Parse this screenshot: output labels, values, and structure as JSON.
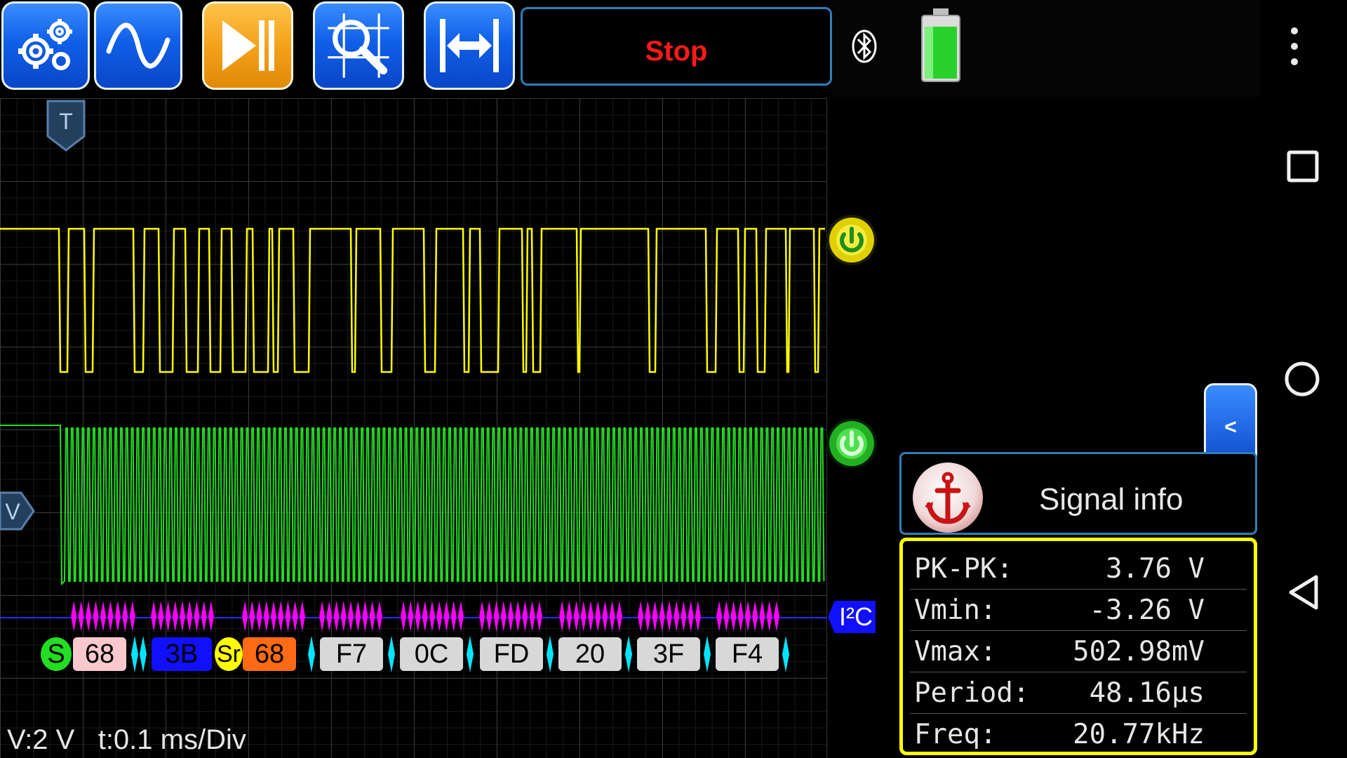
{
  "toolbar": {
    "stop_label": "Stop"
  },
  "scope": {
    "trigger_marker": "T",
    "volt_marker": "V",
    "bus_label": "I²C",
    "volts_per_div": "V:2 V",
    "time_per_div": "t:0.1 ms/Div"
  },
  "decode": {
    "start1": "S",
    "start2": "Sr",
    "bytes": [
      "68",
      "3B",
      "68",
      "F7",
      "0C",
      "FD",
      "20",
      "3F",
      "F4"
    ]
  },
  "signal_info": {
    "collapse": "<",
    "title": "Signal info",
    "rows": [
      {
        "label": "PK-PK:",
        "value": "3.76 V"
      },
      {
        "label": "Vmin:",
        "value": "-3.26 V"
      },
      {
        "label": "Vmax:",
        "value": "502.98mV"
      },
      {
        "label": "Period:",
        "value": "48.16µs"
      },
      {
        "label": "Freq:",
        "value": "20.77kHz"
      }
    ]
  },
  "colors": {
    "ch1": "#ffff00",
    "ch2": "#22dd22",
    "decode_marker": "#ff00ff",
    "separator": "#00e5ff",
    "toolbar_blue": "#1060e8",
    "toolbar_orange": "#f4a21a",
    "stop_text": "#ff1a1a"
  },
  "icons": {
    "settings": "gears-icon",
    "waveform": "sine-wave-icon",
    "run": "play-pause-icon",
    "measure": "magnifier-cursor-icon",
    "fit": "horizontal-fit-icon",
    "bluetooth": "bluetooth-icon",
    "battery": "battery-icon",
    "menu": "overflow-menu-icon",
    "recents": "square-icon",
    "home": "circle-icon",
    "back": "triangle-back-icon"
  }
}
